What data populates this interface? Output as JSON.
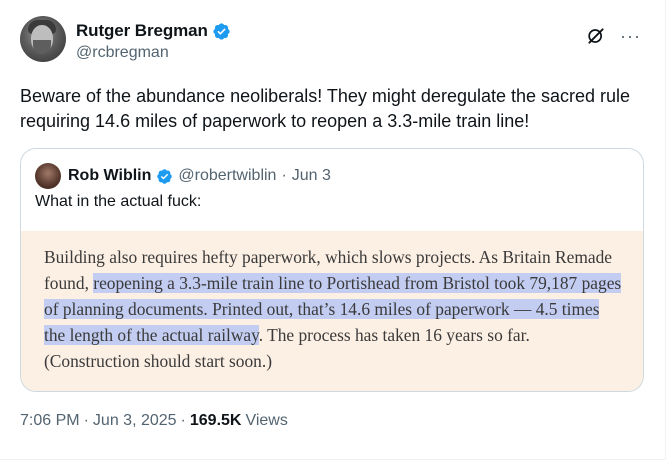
{
  "author": {
    "display_name": "Rutger Bregman",
    "handle": "@rcbregman",
    "verified_color": "#1d9bf0"
  },
  "icons": {
    "grok": "grok-icon",
    "more": "more-icon",
    "verified": "verified-badge-icon"
  },
  "tweet": {
    "text": "Beware of the abundance neoliberals! They might deregulate the sacred rule requiring 14.6 miles of paperwork to reopen a 3.3-mile train line!"
  },
  "quoted": {
    "display_name": "Rob Wiblin",
    "handle": "@robertwiblin",
    "separator": "·",
    "date": "Jun 3",
    "text": "What in the actual fuck:",
    "image": {
      "background": "#fcefe3",
      "highlight": "#c3cdf2",
      "text_before": "Building also requires hefty paperwork, which slows projects. As Britain Remade found, ",
      "text_highlighted": "reopening a 3.3-mile train line to Portishead from Bristol took 79,187 pages of planning documents. Printed out, that’s 14.6 miles of paperwork — 4.5 times the length of the actual railway",
      "text_after": ". The process has taken 16 years so far. (Construction should start soon.)"
    }
  },
  "meta": {
    "time": "7:06 PM",
    "sep1": "·",
    "date": "Jun 3, 2025",
    "sep2": "·",
    "views_count": "169.5K",
    "views_label": "Views"
  }
}
